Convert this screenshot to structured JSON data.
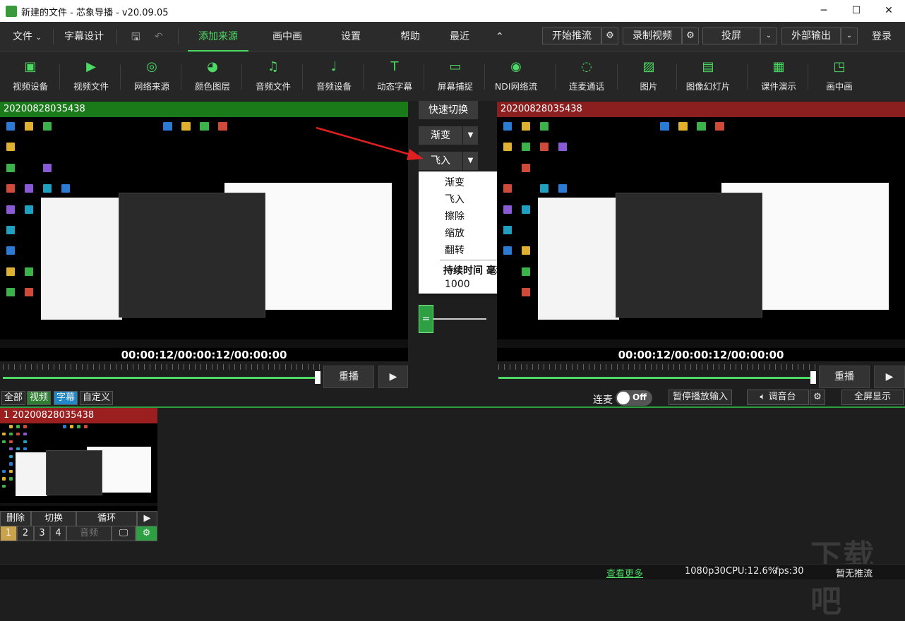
{
  "window": {
    "title": "新建的文件 - 芯象导播 - v20.09.05"
  },
  "menu": {
    "file": "文件",
    "subtitle_design": "字幕设计",
    "add_source": "添加来源",
    "pip": "画中画",
    "settings": "设置",
    "help": "帮助",
    "recent": "最近",
    "start_stream": "开始推流",
    "record": "录制视频",
    "cast": "投屏",
    "external_output": "外部输出",
    "login": "登录"
  },
  "toolbar": [
    {
      "label": "视频设备",
      "icon": "video-camera-icon"
    },
    {
      "label": "视频文件",
      "icon": "play-file-icon"
    },
    {
      "label": "网络来源",
      "icon": "network-icon"
    },
    {
      "label": "颜色图层",
      "icon": "palette-icon"
    },
    {
      "label": "音频文件",
      "icon": "music-file-icon"
    },
    {
      "label": "音频设备",
      "icon": "microphone-icon"
    },
    {
      "label": "动态字幕",
      "icon": "text-icon"
    },
    {
      "label": "屏幕捕捉",
      "icon": "monitor-icon"
    },
    {
      "label": "NDI网络流",
      "icon": "ndi-icon"
    },
    {
      "label": "连麦通话",
      "icon": "call-icon"
    },
    {
      "label": "图片",
      "icon": "image-icon"
    },
    {
      "label": "图像幻灯片",
      "icon": "slideshow-icon"
    },
    {
      "label": "课件演示",
      "icon": "presentation-icon"
    },
    {
      "label": "画中画",
      "icon": "pip-icon"
    }
  ],
  "preview": {
    "source_name": "20200828035438",
    "timecode": "00:00:12/00:00:12/00:00:00",
    "replay": "重播"
  },
  "program": {
    "source_name": "20200828035438",
    "timecode": "00:00:12/00:00:12/00:00:00",
    "replay": "重播"
  },
  "center": {
    "quick_switch": "快速切换",
    "transition1": "渐变",
    "transition2": "飞入",
    "dropdown_items": [
      "渐变",
      "飞入",
      "擦除",
      "缩放",
      "翻转"
    ],
    "duration_label": "持续时间 毫秒",
    "duration_value": "1000"
  },
  "filters": {
    "all": "全部",
    "video": "视频",
    "subtitle": "字幕",
    "custom": "自定义"
  },
  "program_controls": {
    "lianmai": "连麦",
    "toggle": "Off",
    "pause_input": "暂停播放输入",
    "mixer": "调音台",
    "fullscreen": "全屏显示"
  },
  "source_card": {
    "title": "1 20200828035438",
    "delete": "删除",
    "switch": "切换",
    "loop": "循环",
    "pages": [
      "1",
      "2",
      "3",
      "4"
    ],
    "audio": "音频"
  },
  "status": {
    "more": "查看更多",
    "resolution": "1080p30",
    "cpu": "CPU:12.6%",
    "fps": "fps:30",
    "stream": "暂无推流"
  },
  "colors": {
    "accent": "#4cd964",
    "preview_header": "#1a7a1a",
    "program_header": "#8b1f1f",
    "source_header": "#9b1f1f"
  }
}
